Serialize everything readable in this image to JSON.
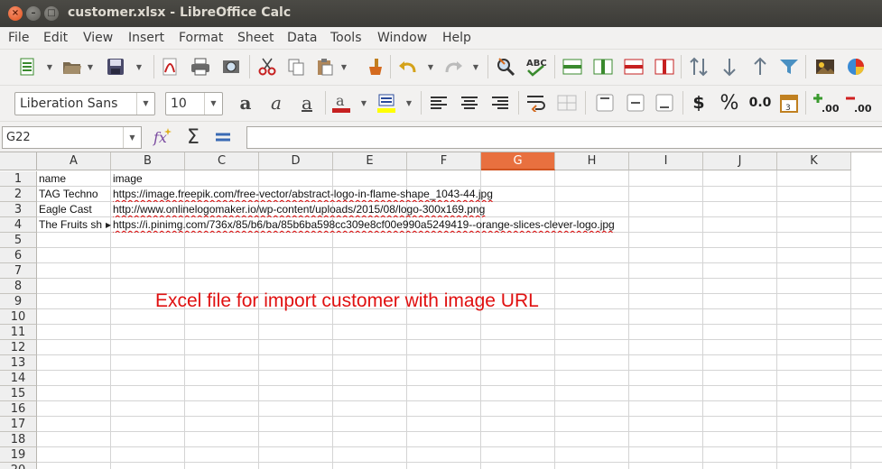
{
  "window": {
    "title": "customer.xlsx - LibreOffice Calc"
  },
  "menu": [
    "File",
    "Edit",
    "View",
    "Insert",
    "Format",
    "Sheet",
    "Data",
    "Tools",
    "Window",
    "Help"
  ],
  "format_bar": {
    "font_name": "Liberation Sans",
    "font_size": "10",
    "currency": "$",
    "percent": "%",
    "number": "0.0",
    "add_decimal": ".00",
    "del_decimal": ".00"
  },
  "formula_bar": {
    "cell_ref": "G22",
    "formula": ""
  },
  "columns": [
    "A",
    "B",
    "C",
    "D",
    "E",
    "F",
    "G",
    "H",
    "I",
    "J",
    "K"
  ],
  "selected_column": "G",
  "rows": [
    "1",
    "2",
    "3",
    "4",
    "5",
    "6",
    "7",
    "8",
    "9",
    "10",
    "11",
    "12",
    "13",
    "14",
    "15",
    "16",
    "17",
    "18",
    "19",
    "20"
  ],
  "cells": {
    "A1": "name",
    "B1": "image",
    "A2": "TAG Techno",
    "B2": "https://image.freepik.com/free-vector/abstract-logo-in-flame-shape_1043-44.jpg",
    "A3": "Eagle Cast",
    "B3": "http://www.onlinelogomaker.io/wp-content/uploads/2015/08/logo-300x169.png",
    "A4": "The Fruits sh",
    "B4": "https://i.pinimg.com/736x/85/b6/ba/85b6ba598cc309e8cf00e990a5249419--orange-slices-clever-logo.jpg"
  },
  "annotation": "Excel file for import customer with image URL",
  "colors": {
    "selected_header": "#e8703f",
    "annotation": "#e01010"
  }
}
